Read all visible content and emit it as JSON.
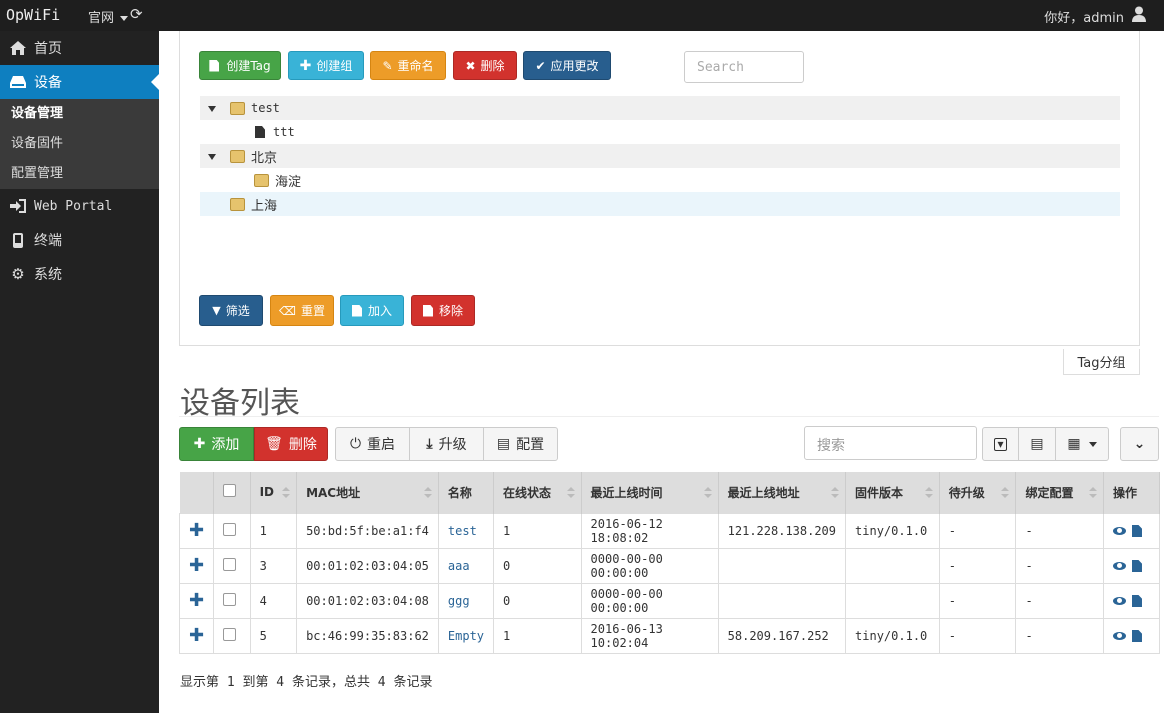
{
  "topbar": {
    "brand": "OpWiFi",
    "site": "官网",
    "greeting": "你好，admin"
  },
  "sidebar": {
    "items": [
      {
        "label": "首页"
      },
      {
        "label": "设备"
      },
      {
        "label": "Web Portal"
      },
      {
        "label": "终端"
      },
      {
        "label": "系统"
      }
    ],
    "sub": [
      {
        "label": "设备管理"
      },
      {
        "label": "设备固件"
      },
      {
        "label": "配置管理"
      }
    ]
  },
  "tagpanel": {
    "buttons": {
      "create_tag": "创建Tag",
      "create_group": "创建组",
      "rename": "重命名",
      "delete": "删除",
      "apply": "应用更改"
    },
    "search_placeholder": "Search",
    "tree": [
      {
        "label": "test"
      },
      {
        "label": "ttt"
      },
      {
        "label": "北京"
      },
      {
        "label": "海淀"
      },
      {
        "label": "上海"
      }
    ],
    "actions": {
      "filter": "筛选",
      "reset": "重置",
      "add": "加入",
      "remove": "移除"
    },
    "tab": "Tag分组"
  },
  "devices": {
    "title": "设备列表",
    "toolbar": {
      "add": "添加",
      "delete": "删除",
      "reboot": "重启",
      "upgrade": "升级",
      "config": "配置",
      "search_placeholder": "搜索"
    },
    "columns": [
      "ID",
      "MAC地址",
      "名称",
      "在线状态",
      "最近上线时间",
      "最近上线地址",
      "固件版本",
      "待升级",
      "绑定配置",
      "操作"
    ],
    "rows": [
      {
        "id": "1",
        "mac": "50:bd:5f:be:a1:f4",
        "name": "test",
        "status": "1",
        "time": "2016-06-12 18:08:02",
        "addr": "121.228.138.209",
        "fw": "tiny/0.1.0",
        "upg": "-",
        "cfg": "-"
      },
      {
        "id": "3",
        "mac": "00:01:02:03:04:05",
        "name": "aaa",
        "status": "0",
        "time": "0000-00-00 00:00:00",
        "addr": "",
        "fw": "",
        "upg": "-",
        "cfg": "-"
      },
      {
        "id": "4",
        "mac": "00:01:02:03:04:08",
        "name": "ggg",
        "status": "0",
        "time": "0000-00-00 00:00:00",
        "addr": "",
        "fw": "",
        "upg": "-",
        "cfg": "-"
      },
      {
        "id": "5",
        "mac": "bc:46:99:35:83:62",
        "name": "Empty",
        "status": "1",
        "time": "2016-06-13 10:02:04",
        "addr": "58.209.167.252",
        "fw": "tiny/0.1.0",
        "upg": "-",
        "cfg": "-"
      }
    ],
    "footer": "显示第 1 到第 4 条记录，总共 4 条记录"
  }
}
